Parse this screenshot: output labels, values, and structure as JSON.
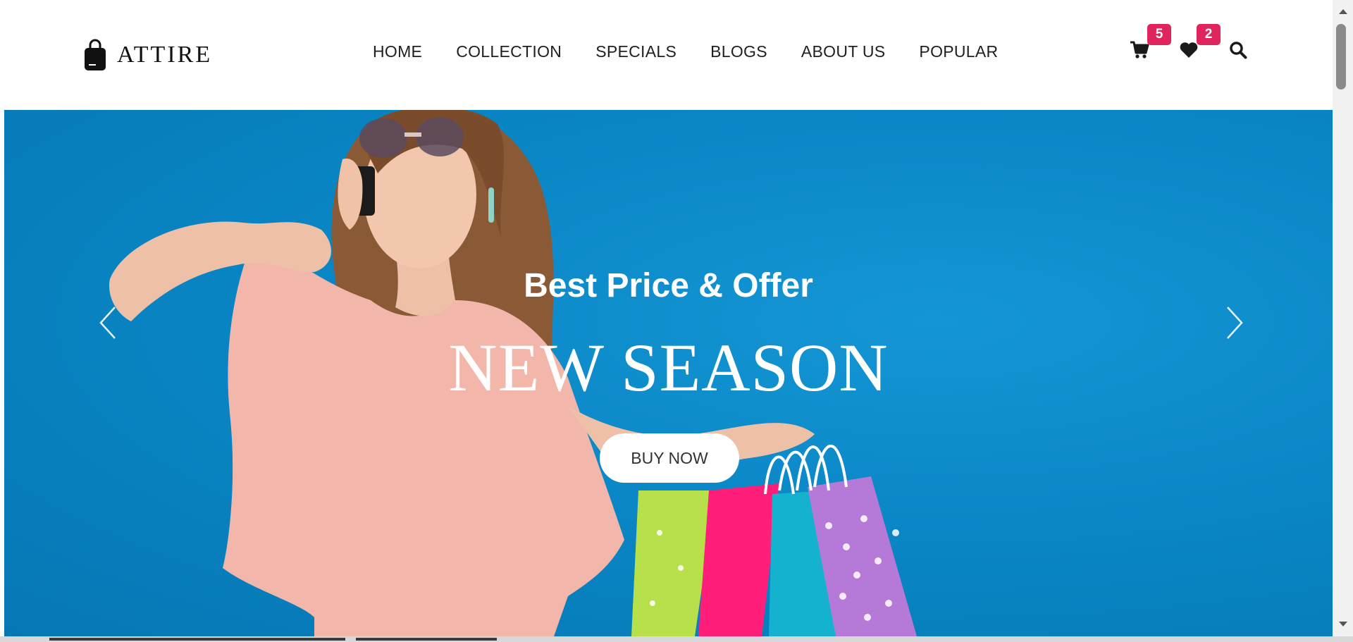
{
  "brand": {
    "name": "ATTIRE",
    "logo_icon": "shopping-bag-icon"
  },
  "nav": {
    "items": [
      {
        "label": "HOME"
      },
      {
        "label": "COLLECTION"
      },
      {
        "label": "SPECIALS"
      },
      {
        "label": "BLOGS"
      },
      {
        "label": "ABOUT US"
      },
      {
        "label": "POPULAR"
      }
    ]
  },
  "header_icons": {
    "cart": {
      "icon": "cart-icon",
      "count": "5"
    },
    "wishlist": {
      "icon": "heart-icon",
      "count": "2"
    },
    "search": {
      "icon": "search-icon"
    }
  },
  "hero": {
    "subtitle": "Best Price & Offer",
    "title": "NEW SEASON",
    "button_label": "BUY NOW",
    "prev_icon": "chevron-left-icon",
    "next_icon": "chevron-right-icon"
  },
  "colors": {
    "hero_background": "#0a87c6",
    "badge": "#e0245e",
    "text_dark": "#1f1f1f",
    "dress": "#f2b7aa",
    "hair": "#8a5a36"
  }
}
